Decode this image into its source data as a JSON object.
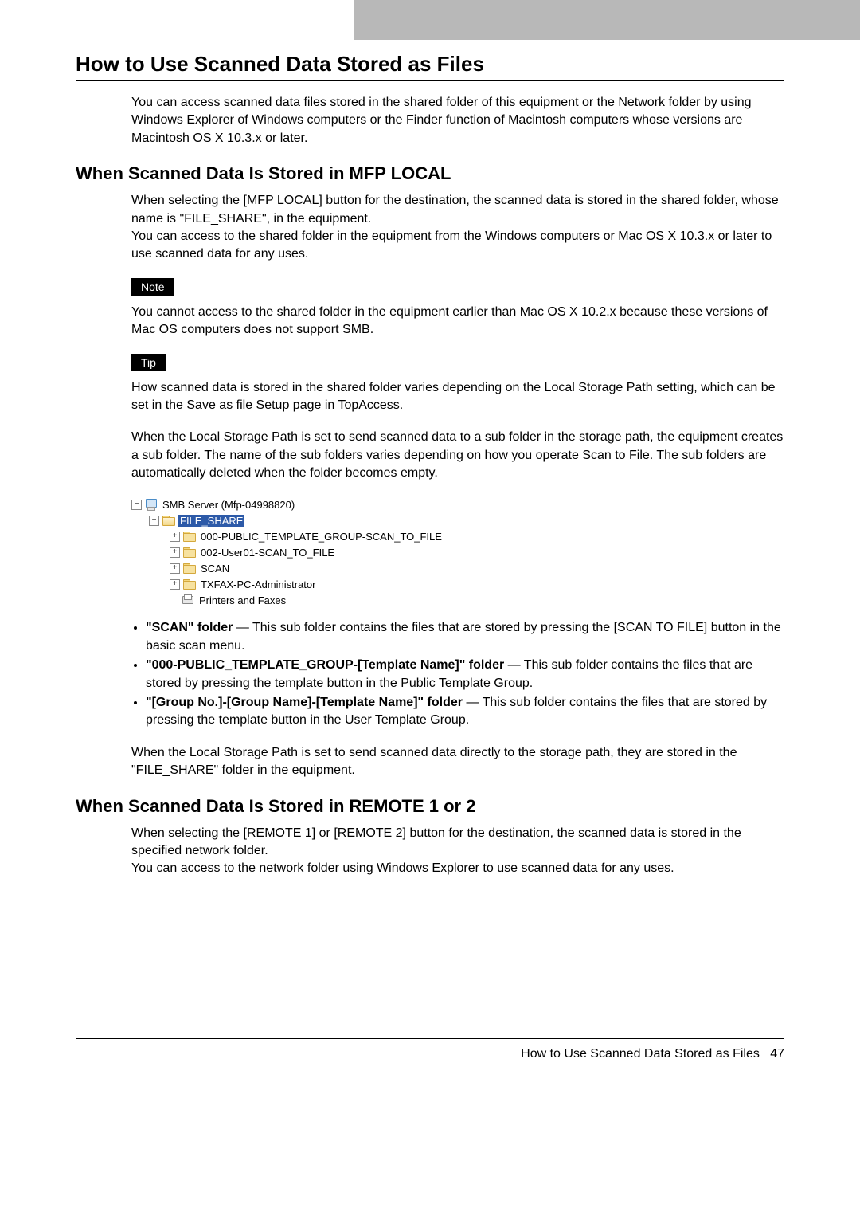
{
  "main_heading": "How to Use Scanned Data Stored as Files",
  "intro": "You can access scanned data files stored in the shared folder of this equipment or the Network folder by using Windows Explorer of Windows computers or the Finder function of Macintosh computers whose versions are Macintosh OS X 10.3.x or later.",
  "section1": {
    "heading": "When Scanned Data Is Stored in MFP LOCAL",
    "para1": "When selecting the [MFP LOCAL] button for the destination, the scanned data is stored in the shared folder, whose name is \"FILE_SHARE\", in the equipment.",
    "para2": "You can access to the shared folder in the equipment from the Windows computers or Mac OS X 10.3.x or later to use scanned data for any uses.",
    "note_label": "Note",
    "note_text": "You cannot access to the shared folder in the equipment earlier than Mac OS X 10.2.x because these versions of Mac OS computers does not support SMB.",
    "tip_label": "Tip",
    "tip_text": "How scanned data is stored in the shared folder varies depending on the Local Storage Path setting, which can be set in the Save as file Setup page in TopAccess.",
    "para3": "When the Local Storage Path is set to send scanned data to a sub folder in the storage path, the equipment creates a sub folder.  The name of the sub folders varies depending on how you operate Scan to File.  The sub folders are automatically deleted when the folder becomes empty.",
    "bullets": [
      {
        "bold": "\"SCAN\" folder",
        "rest": " — This sub folder contains the files that are stored by pressing the [SCAN TO FILE] button in the basic scan menu."
      },
      {
        "bold": "\"000-PUBLIC_TEMPLATE_GROUP-[Template Name]\" folder",
        "rest": " — This sub folder contains the files that are stored by pressing the template button in the Public Template Group."
      },
      {
        "bold": "\"[Group No.]-[Group Name]-[Template Name]\" folder",
        "rest": " — This sub folder contains the files that are stored by pressing the template button in the User Template Group."
      }
    ],
    "para4": "When the Local Storage Path is set to send scanned data directly to the storage path, they are stored in the \"FILE_SHARE\" folder in the equipment."
  },
  "tree": {
    "root": "SMB Server (Mfp-04998820)",
    "n1": "FILE_SHARE",
    "n2": "000-PUBLIC_TEMPLATE_GROUP-SCAN_TO_FILE",
    "n3": "002-User01-SCAN_TO_FILE",
    "n4": "SCAN",
    "n5": "TXFAX-PC-Administrator",
    "n6": "Printers and Faxes"
  },
  "section2": {
    "heading": "When Scanned Data Is Stored in REMOTE 1 or 2",
    "para1": "When selecting the [REMOTE 1] or [REMOTE 2] button for the destination, the scanned data is stored in the specified network folder.",
    "para2": "You can access to the network folder using Windows Explorer to use scanned data for any uses."
  },
  "footer": {
    "text": "How to Use Scanned Data Stored as Files",
    "page": "47"
  }
}
